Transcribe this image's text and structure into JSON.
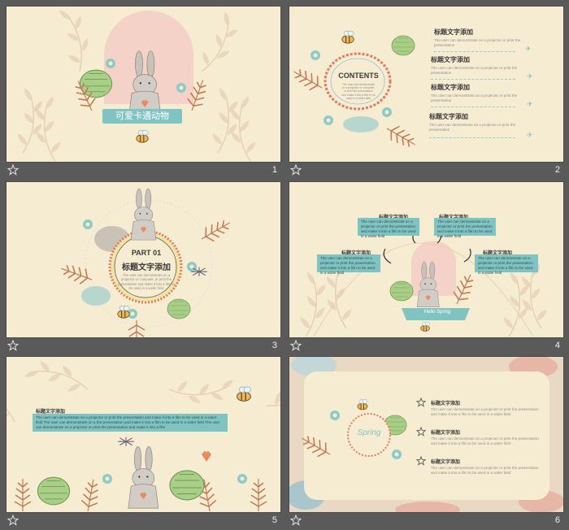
{
  "slides": [
    {
      "number": "1",
      "title": "可爱卡通动物"
    },
    {
      "number": "2",
      "center_title": "CONTENTS",
      "center_text": "The user can demonstrate on a projector or computer, or print the presentation and make it into a film to be used in a wider field",
      "items": [
        {
          "title": "标题文字添加",
          "text": "The user can demonstrate  on a projector  or print the presentation"
        },
        {
          "title": "标题文字添加",
          "text": "The user can demonstrate  on a projector  or print the presentation"
        },
        {
          "title": "标题文字添加",
          "text": "The user can demonstrate  on a projector  or print the presentation"
        },
        {
          "title": "标题文字添加",
          "text": "The user can demonstrate  on a projector  or print the presentation"
        }
      ]
    },
    {
      "number": "3",
      "part": "PART 01",
      "title": "标题文字添加",
      "text": "The user can demonstrate  on a projector or computer, or print the presentation  and make it into a film to be used in a wider field"
    },
    {
      "number": "4",
      "boxes": [
        {
          "title": "标题文字添加",
          "text": "The user can demonstrate on a projector or print the presentation and make it into a film to be used in a wider field"
        },
        {
          "title": "标题文字添加",
          "text": "The user can demonstrate on a projector or print the presentation and make it into a film to be used in a wider field"
        },
        {
          "title": "标题文字添加",
          "text": "The user can demonstrate on a projector or print the presentation and make it into a film to be used in a wider field"
        },
        {
          "title": "标题文字添加",
          "text": "The user can demonstrate on a projector or print the presentation and make it into a film to be used in a wider field"
        }
      ],
      "logo_text": "Hello Spring"
    },
    {
      "number": "5",
      "title": "标题文字添加",
      "text": "The user can demonstrate on a projector or print the presentation and make it into a film to be used in a wider field The user can demonstrate on a the presentation and make it into a film to be used in a wider field The user can demonstrate on a projector or print the presentation and make it into a film"
    },
    {
      "number": "6",
      "logo_text": "Spring",
      "items": [
        {
          "title": "标题文字添加",
          "text": "The user can demonstrate on a projector or print the presentation and make it into a film to be used in a wider field"
        },
        {
          "title": "标题文字添加",
          "text": "The user can demonstrate on a projector or print the presentation and make it into a film to be used in a wider field"
        },
        {
          "title": "标题文字添加",
          "text": "The user can demonstrate on a projector or print the presentation and make it into a film to be used in a wider field"
        }
      ]
    }
  ],
  "icons": {
    "slide_marker": "star-icon",
    "bunny": "bunny-icon",
    "bee": "bee-icon",
    "plane": "paper-plane-icon",
    "outline_star": "star-outline-icon"
  },
  "colors": {
    "background": "#5a5a5a",
    "slide": "#f6ecd2",
    "accent_teal": "#7fc4c2",
    "accent_coral": "#e07a63"
  }
}
